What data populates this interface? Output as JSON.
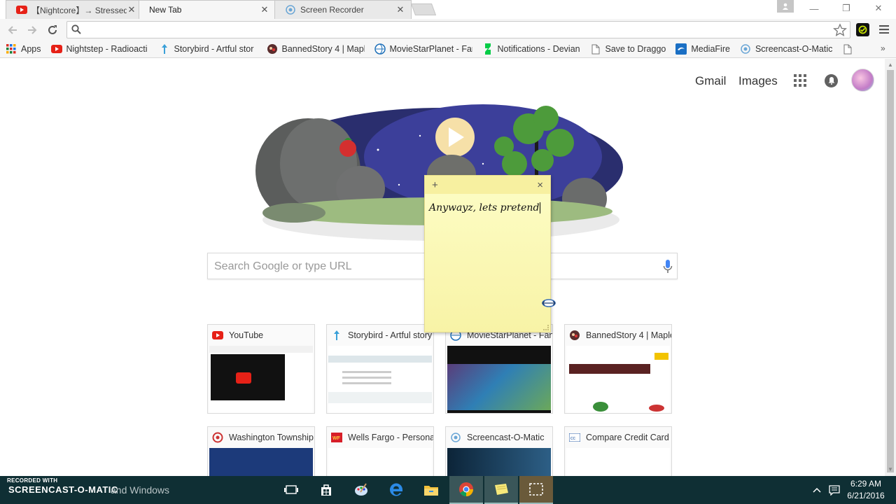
{
  "tabs": [
    {
      "title": "【Nightcore】→ Stressed O",
      "active": false,
      "icon": "youtube-icon"
    },
    {
      "title": "New Tab",
      "active": true,
      "icon": ""
    },
    {
      "title": "Screen Recorder",
      "active": false,
      "icon": "screencast-icon"
    }
  ],
  "window_controls": {
    "user": "user-icon",
    "minimize": "—",
    "restore": "❐",
    "close": "✕"
  },
  "toolbar": {
    "back": "back-icon",
    "forward": "forward-icon",
    "reload": "reload-icon",
    "omnibox_value": "",
    "star": "star-icon",
    "menu": "menu-icon"
  },
  "bookmarks": [
    {
      "label": "Apps",
      "icon": "apps-icon"
    },
    {
      "label": "Nightstep - Radioacti",
      "icon": "youtube-icon"
    },
    {
      "label": "Storybird - Artful stor",
      "icon": "storybird-icon"
    },
    {
      "label": "BannedStory 4 | Mapl",
      "icon": "bannedstory-icon"
    },
    {
      "label": "MovieStarPlanet - Fan",
      "icon": "msp-icon"
    },
    {
      "label": "Notifications - Devian",
      "icon": "deviantart-icon"
    },
    {
      "label": "Save to Draggo",
      "icon": "page-icon"
    },
    {
      "label": "MediaFire",
      "icon": "mediafire-icon"
    },
    {
      "label": "Screencast-O-Matic",
      "icon": "screencast-icon"
    }
  ],
  "google_links": {
    "gmail": "Gmail",
    "images": "Images"
  },
  "search": {
    "placeholder": "Search Google or type URL"
  },
  "most_visited": [
    {
      "title": "YouTube",
      "icon": "youtube-icon"
    },
    {
      "title": "Storybird - Artful story",
      "icon": "storybird-icon"
    },
    {
      "title": "MovieStarPlanet - Fan",
      "icon": "msp-icon"
    },
    {
      "title": "BannedStory 4 | Maple",
      "icon": "bannedstory-icon"
    },
    {
      "title": "Washington Township",
      "icon": "washington-icon"
    },
    {
      "title": "Wells Fargo - Personal",
      "icon": "wellsfargo-icon"
    },
    {
      "title": "Screencast-O-Matic",
      "icon": "screencast-icon"
    },
    {
      "title": "Compare Credit Card",
      "icon": "cc-icon"
    }
  ],
  "sticky_note": {
    "add": "+",
    "close": "×",
    "text": "Anywayz, lets pretend"
  },
  "taskbar": {
    "watermark": "RECORDED WITH",
    "brand": "SCREENCAST-O-MATIC",
    "search_text": "and Windows",
    "time": "6:29 AM",
    "date": "6/21/2016"
  },
  "colors": {
    "tab_bg": "#e9e9e9",
    "active_tab_bg": "#f6f6f6",
    "taskbar_bg": "#0f2f34",
    "sticky_bg": "#fdfdc6",
    "youtube_red": "#e62117"
  }
}
